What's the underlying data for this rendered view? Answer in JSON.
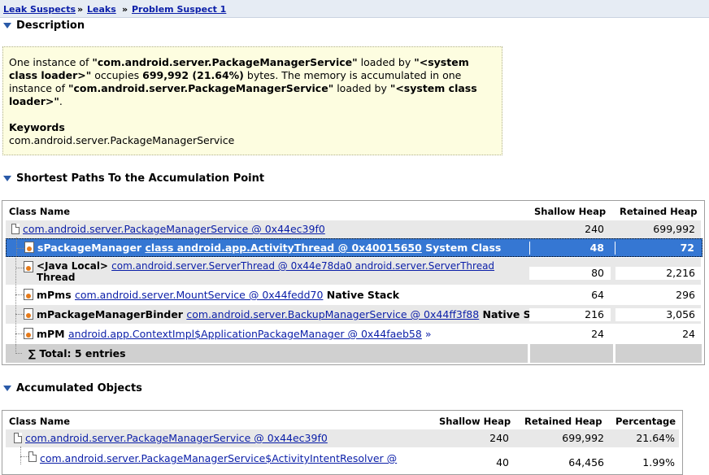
{
  "breadcrumbs": [
    "Leak Suspects",
    "Leaks",
    "Problem Suspect 1"
  ],
  "breadcrumb_sep": "»",
  "description": {
    "heading": "Description",
    "p1": "One instance of ",
    "class_name": "\"com.android.server.PackageManagerService\"",
    "p2": " loaded by ",
    "loader": "\"<system class loader>\"",
    "p3": " occupies ",
    "bytes": "699,992 (21.64%)",
    "p4": " bytes. The memory is accumulated in one instance of ",
    "class_name2": "\"com.android.server.PackageManagerService\"",
    "p5": " loaded by ",
    "loader2": "\"<system class loader>\"",
    "p6": ".",
    "keywords_label": "Keywords",
    "keywords": "com.android.server.PackageManagerService"
  },
  "paths": {
    "heading": "Shortest Paths To the Accumulation Point",
    "columns": [
      "Class Name",
      "Shallow Heap",
      "Retained Heap"
    ],
    "rows": [
      {
        "prefix": "",
        "link": "com.android.server.PackageManagerService @ 0x44ec39f0",
        "suffix": "",
        "shallow": "240",
        "retained": "699,992"
      },
      {
        "prefix": "sPackageManager ",
        "link": "class android.app.ActivityThread @ 0x40015650",
        "suffix": " System Class",
        "shallow": "48",
        "retained": "72"
      },
      {
        "prefix": "<Java Local> ",
        "link": "com.android.server.ServerThread @ 0x44e78da0 android.server.ServerThread",
        "suffix": "Thread",
        "shallow": "80",
        "retained": "2,216"
      },
      {
        "prefix": "mPms ",
        "link": "com.android.server.MountService @ 0x44fedd70",
        "suffix": " Native Stack",
        "shallow": "64",
        "retained": "296"
      },
      {
        "prefix": "mPackageManagerBinder ",
        "link": "com.android.server.BackupManagerService @ 0x44ff3f88",
        "suffix": " Native Stack",
        "shallow": "216",
        "retained": "3,056"
      },
      {
        "prefix": "mPM ",
        "link": "android.app.ContextImpl$ApplicationPackageManager @ 0x44faeb58",
        "suffix": " »",
        "shallow": "24",
        "retained": "24"
      }
    ],
    "total": "Total: 5 entries"
  },
  "accumulated": {
    "heading": "Accumulated Objects",
    "columns": [
      "Class Name",
      "Shallow Heap",
      "Retained Heap",
      "Percentage"
    ],
    "rows": [
      {
        "link": "com.android.server.PackageManagerService @ 0x44ec39f0",
        "shallow": "240",
        "retained": "699,992",
        "percent": "21.64%"
      },
      {
        "link": "com.android.server.PackageManagerService$ActivityIntentResolver @",
        "shallow": "40",
        "retained": "64,456",
        "percent": "1.99%"
      }
    ]
  },
  "colors": {
    "selected_row": "#3577d3",
    "link": "#0a1ea8",
    "description_bg": "#fdfde0",
    "breadcrumb_bg": "#e6ecf4"
  }
}
